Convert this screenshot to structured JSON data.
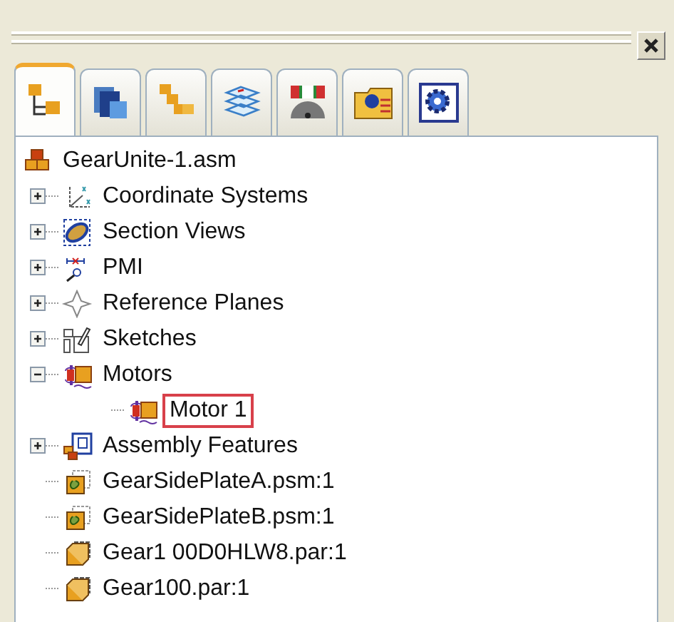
{
  "tabs": [
    {
      "kind": "tree",
      "selected": true
    },
    {
      "kind": "layers",
      "selected": false
    },
    {
      "kind": "blocks",
      "selected": false
    },
    {
      "kind": "sheets",
      "selected": false
    },
    {
      "kind": "gauge",
      "selected": false
    },
    {
      "kind": "folder",
      "selected": false
    },
    {
      "kind": "gear",
      "selected": false
    }
  ],
  "tree": {
    "label": "GearUnite-1.asm",
    "kind": "assembly",
    "selected": false,
    "children": [
      {
        "label": "Coordinate Systems",
        "kind": "coords",
        "expanded": false,
        "selected": false
      },
      {
        "label": "Section Views",
        "kind": "section",
        "expanded": false,
        "selected": false
      },
      {
        "label": "PMI",
        "kind": "pmi",
        "expanded": false,
        "selected": false
      },
      {
        "label": "Reference Planes",
        "kind": "planes",
        "expanded": false,
        "selected": false
      },
      {
        "label": "Sketches",
        "kind": "sketch",
        "expanded": false,
        "selected": false
      },
      {
        "label": "Motors",
        "kind": "motor",
        "expanded": true,
        "selected": false,
        "children": [
          {
            "label": "Motor 1",
            "kind": "motor",
            "selected": true
          }
        ]
      },
      {
        "label": "Assembly Features",
        "kind": "features",
        "expanded": false,
        "selected": false
      },
      {
        "label": "GearSidePlateA.psm:1",
        "kind": "sheetpart",
        "selected": false
      },
      {
        "label": "GearSidePlateB.psm:1",
        "kind": "sheetpart",
        "selected": false
      },
      {
        "label": "Gear1 00D0HLW8.par:1",
        "kind": "part",
        "selected": false
      },
      {
        "label": "Gear100.par:1",
        "kind": "part",
        "selected": false
      }
    ]
  }
}
